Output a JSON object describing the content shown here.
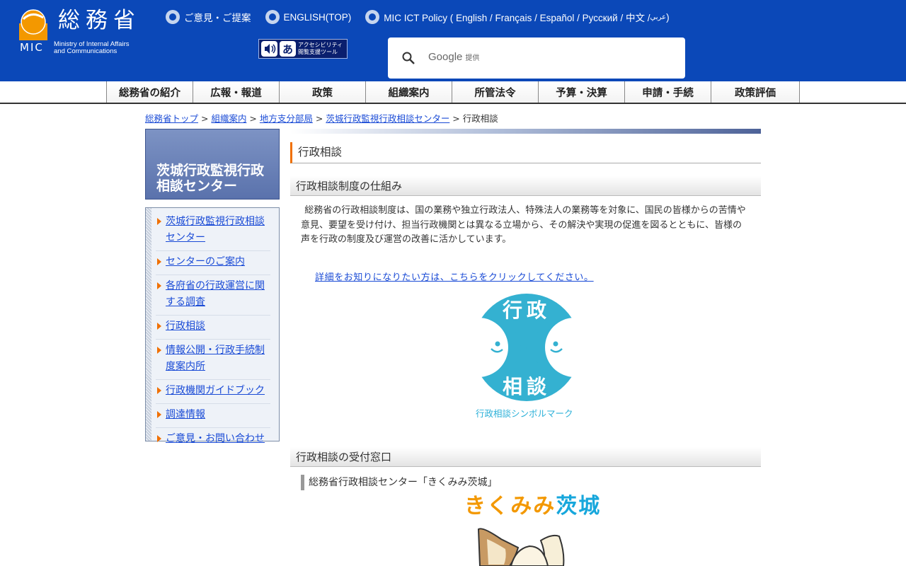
{
  "header": {
    "logo_jp": "総務省",
    "logo_abbr": "MIC",
    "logo_en_line1": "Ministry of Internal Affairs",
    "logo_en_line2": "and Communications",
    "top_links": [
      "ご意見・ご提案",
      "ENGLISH(TOP)",
      "MIC ICT Policy ( English / Français / Español / Русский / 中文 / "
    ],
    "top_link_arabic": "عربي",
    "top_link_close": " )",
    "access_tool_line1": "アクセシビリティ",
    "access_tool_line2": "閲覧支援ツール",
    "access_tool_letter": "あ",
    "search_brand": "Google",
    "search_provided": "提供"
  },
  "nav": [
    "総務省の紹介",
    "広報・報道",
    "政策",
    "組織案内",
    "所管法令",
    "予算・決算",
    "申請・手続",
    "政策評価"
  ],
  "breadcrumb": {
    "links": [
      "総務省トップ",
      "組織案内",
      "地方支分部局",
      "茨城行政監視行政相談センター"
    ],
    "separator": " > ",
    "current": "行政相談"
  },
  "sidebar": {
    "title": "茨城行政監視行政相談センター",
    "items": [
      "茨城行政監視行政相談センター",
      "センターのご案内",
      "各府省の行政運営に関する調査",
      "行政相談",
      "情報公開・行政手続制度案内所",
      "行政機関ガイドブック",
      "調達情報",
      "ご意見・お問い合わせ"
    ]
  },
  "main": {
    "page_title": "行政相談",
    "section1_title": "行政相談制度の仕組み",
    "section1_body": "総務省の行政相談制度は、国の業務や独立行政法人、特殊法人の業務等を対象に、国民の皆様からの苦情や意見、要望を受け付け、担当行政機関とは異なる立場から、その解決や実現の促進を図るとともに、皆様の声を行政の制度及び運営の改善に活かしています。",
    "detail_link": "詳細をお知りになりたい方は、こちらをクリックしてください。",
    "symbol_top": "行政",
    "symbol_bottom": "相談",
    "symbol_caption": "行政相談シンボルマーク",
    "section2_title": "行政相談の受付窓口",
    "sub_heading": "総務省行政相談センター「きくみみ茨城」",
    "logo_kikumimi": "きくみみ",
    "logo_ibaraki": "茨城"
  },
  "colors": {
    "header_bg": "#0b48b8",
    "accent_orange": "#f07000",
    "symbol_cyan": "#34b1d1",
    "link": "#1a4bd6"
  }
}
